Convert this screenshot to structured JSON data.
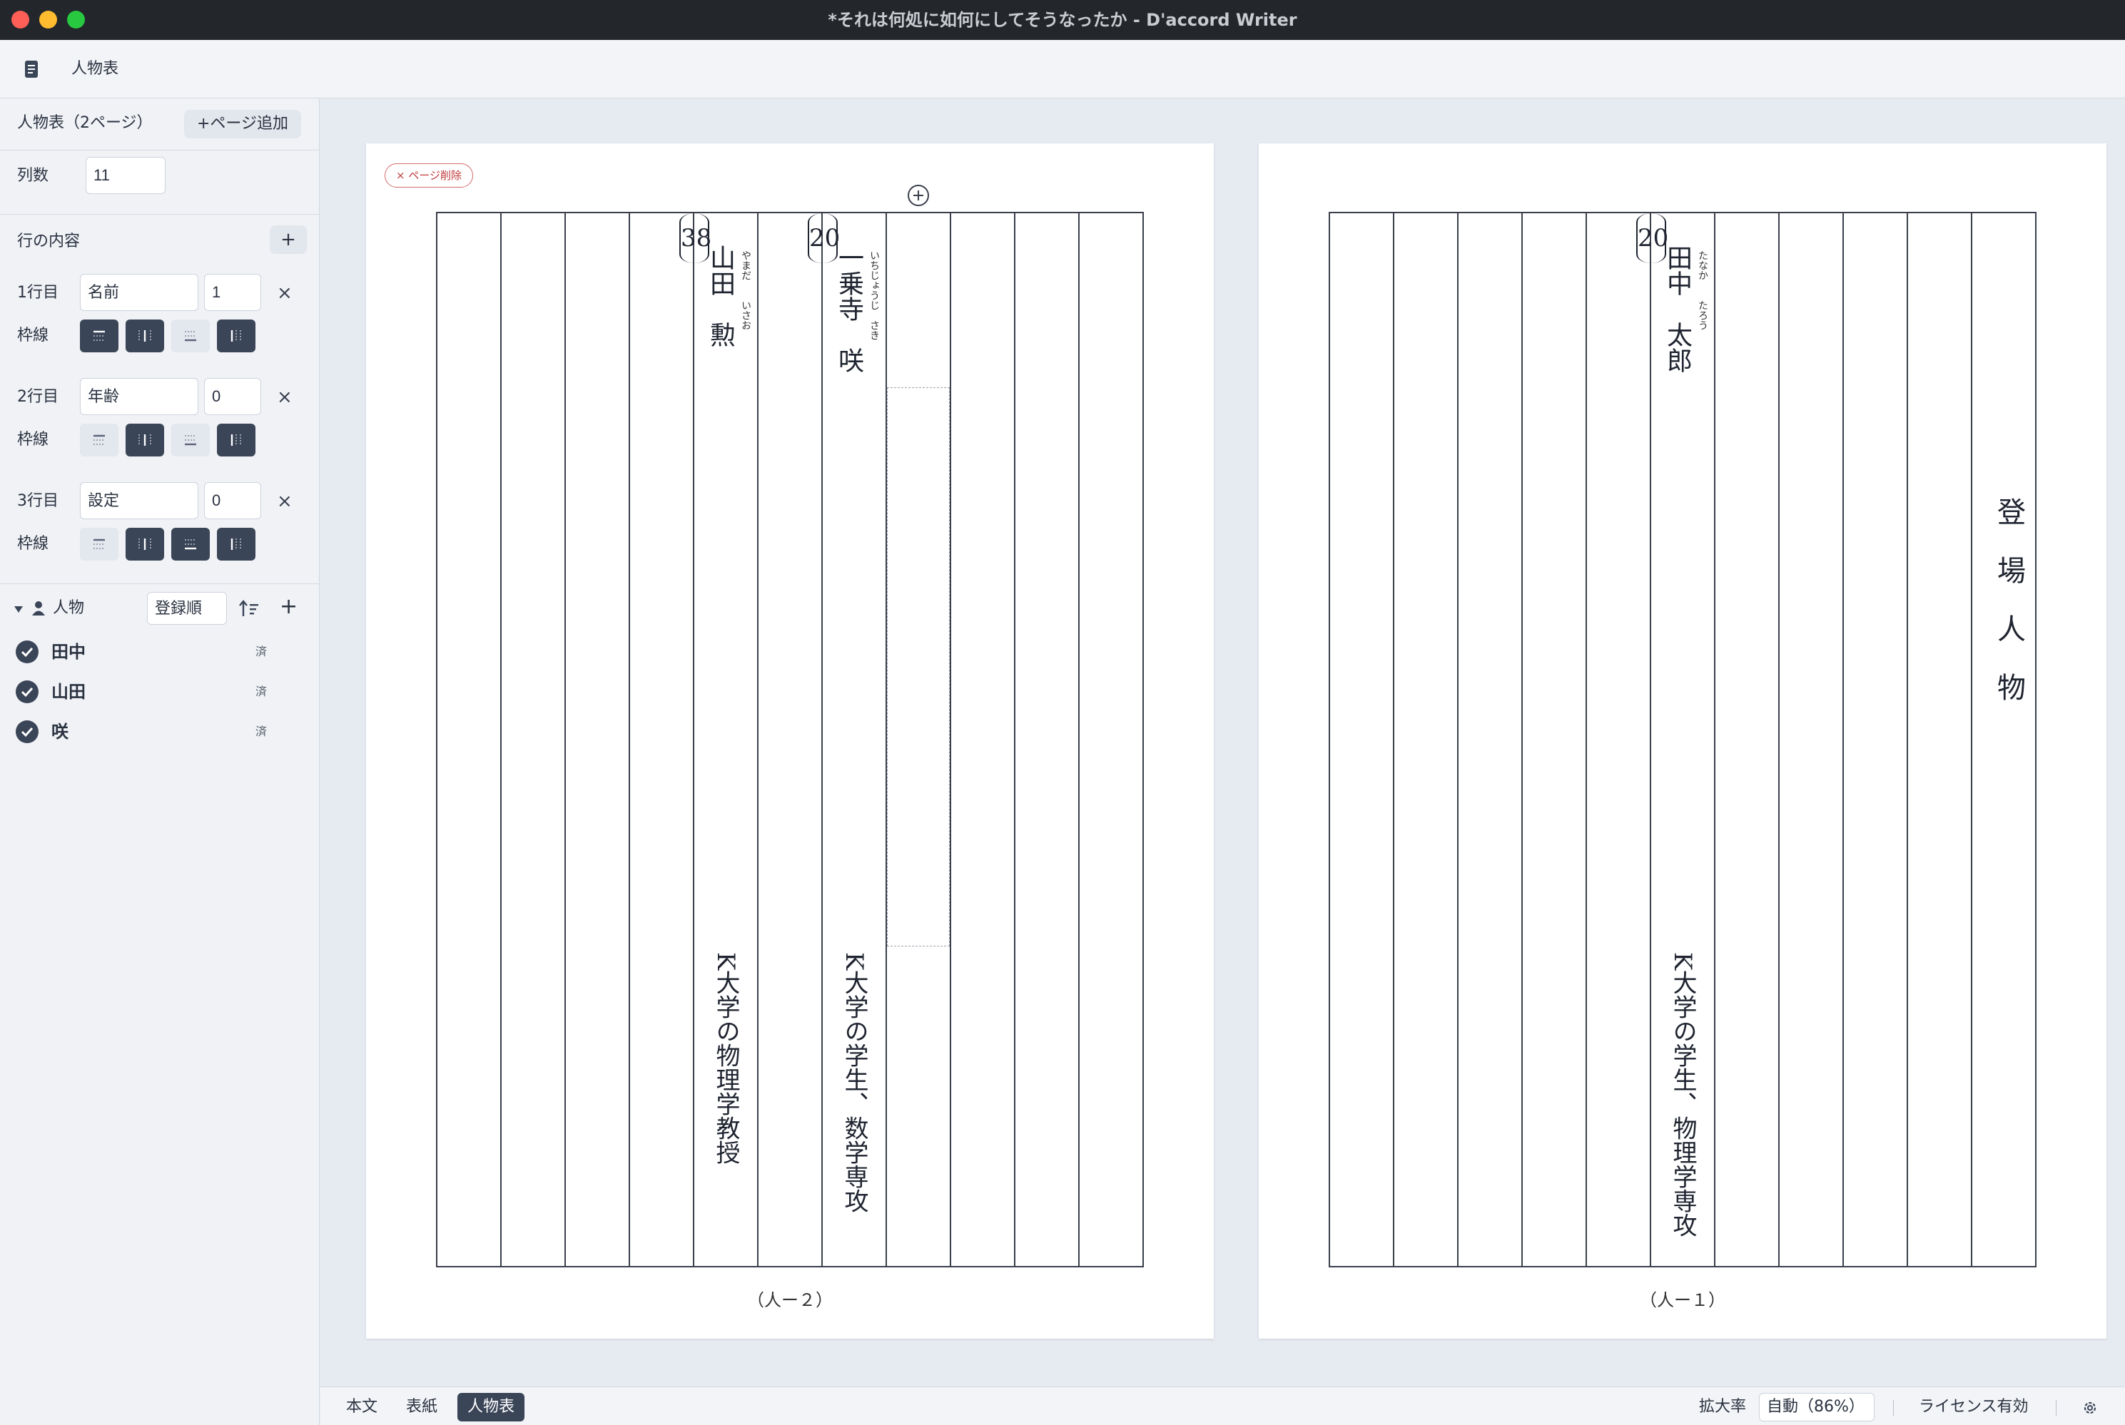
{
  "window": {
    "title": "*それは何処に如何にしてそうなったか - D'accord Writer"
  },
  "toolbar": {
    "view_label": "人物表"
  },
  "sidebar": {
    "sheet_title": "人物表（2ページ）",
    "add_page_label": "+ページ追加",
    "columns_label": "列数",
    "columns_value": "11",
    "rows_header": "行の内容",
    "add_row_label": "+",
    "rows": [
      {
        "label": "1行目",
        "field": "名前",
        "count": "1",
        "border_label": "枠線",
        "borders": [
          true,
          true,
          false,
          true
        ]
      },
      {
        "label": "2行目",
        "field": "年齢",
        "count": "0",
        "border_label": "枠線",
        "borders": [
          false,
          true,
          false,
          true
        ]
      },
      {
        "label": "3行目",
        "field": "設定",
        "count": "0",
        "border_label": "枠線",
        "borders": [
          false,
          true,
          true,
          true
        ]
      }
    ],
    "remove_row_label": "×",
    "people_header": "人物",
    "sort_value": "登録順",
    "add_person_label": "+",
    "people": [
      {
        "name": "田中",
        "status": "済"
      },
      {
        "name": "山田",
        "status": "済"
      },
      {
        "name": "咲",
        "status": "済"
      }
    ]
  },
  "pages": [
    {
      "delete_label": "× ページ削除",
      "page_number": "（人ー２）",
      "entries": [
        {
          "name": "山田　勲",
          "reading": "やまだ　　いさお",
          "age": "38",
          "setting": "K大学の物理学教授"
        },
        {
          "name": "一乗寺　咲",
          "reading": "いちじょうじ　さき",
          "age": "20",
          "setting": "K大学の学生、数学専攻"
        }
      ]
    },
    {
      "page_number": "（人ー１）",
      "entries": [
        {
          "name": "田中　太郎",
          "reading": "たなか　　たろう",
          "age": "20",
          "setting": "K大学の学生、物理学専攻"
        }
      ],
      "heading": "登場人物"
    }
  ],
  "statusbar": {
    "tabs": [
      "本文",
      "表紙",
      "人物表"
    ],
    "active_tab": "人物表",
    "zoom_label": "拡大率",
    "zoom_value": "自動（86%）",
    "license": "ライセンス有効"
  },
  "colors": {
    "accent": "#3a4558",
    "title_bar": "#23262b",
    "close": "#ff5f57",
    "minimize": "#febc2e",
    "zoom": "#28c840"
  }
}
